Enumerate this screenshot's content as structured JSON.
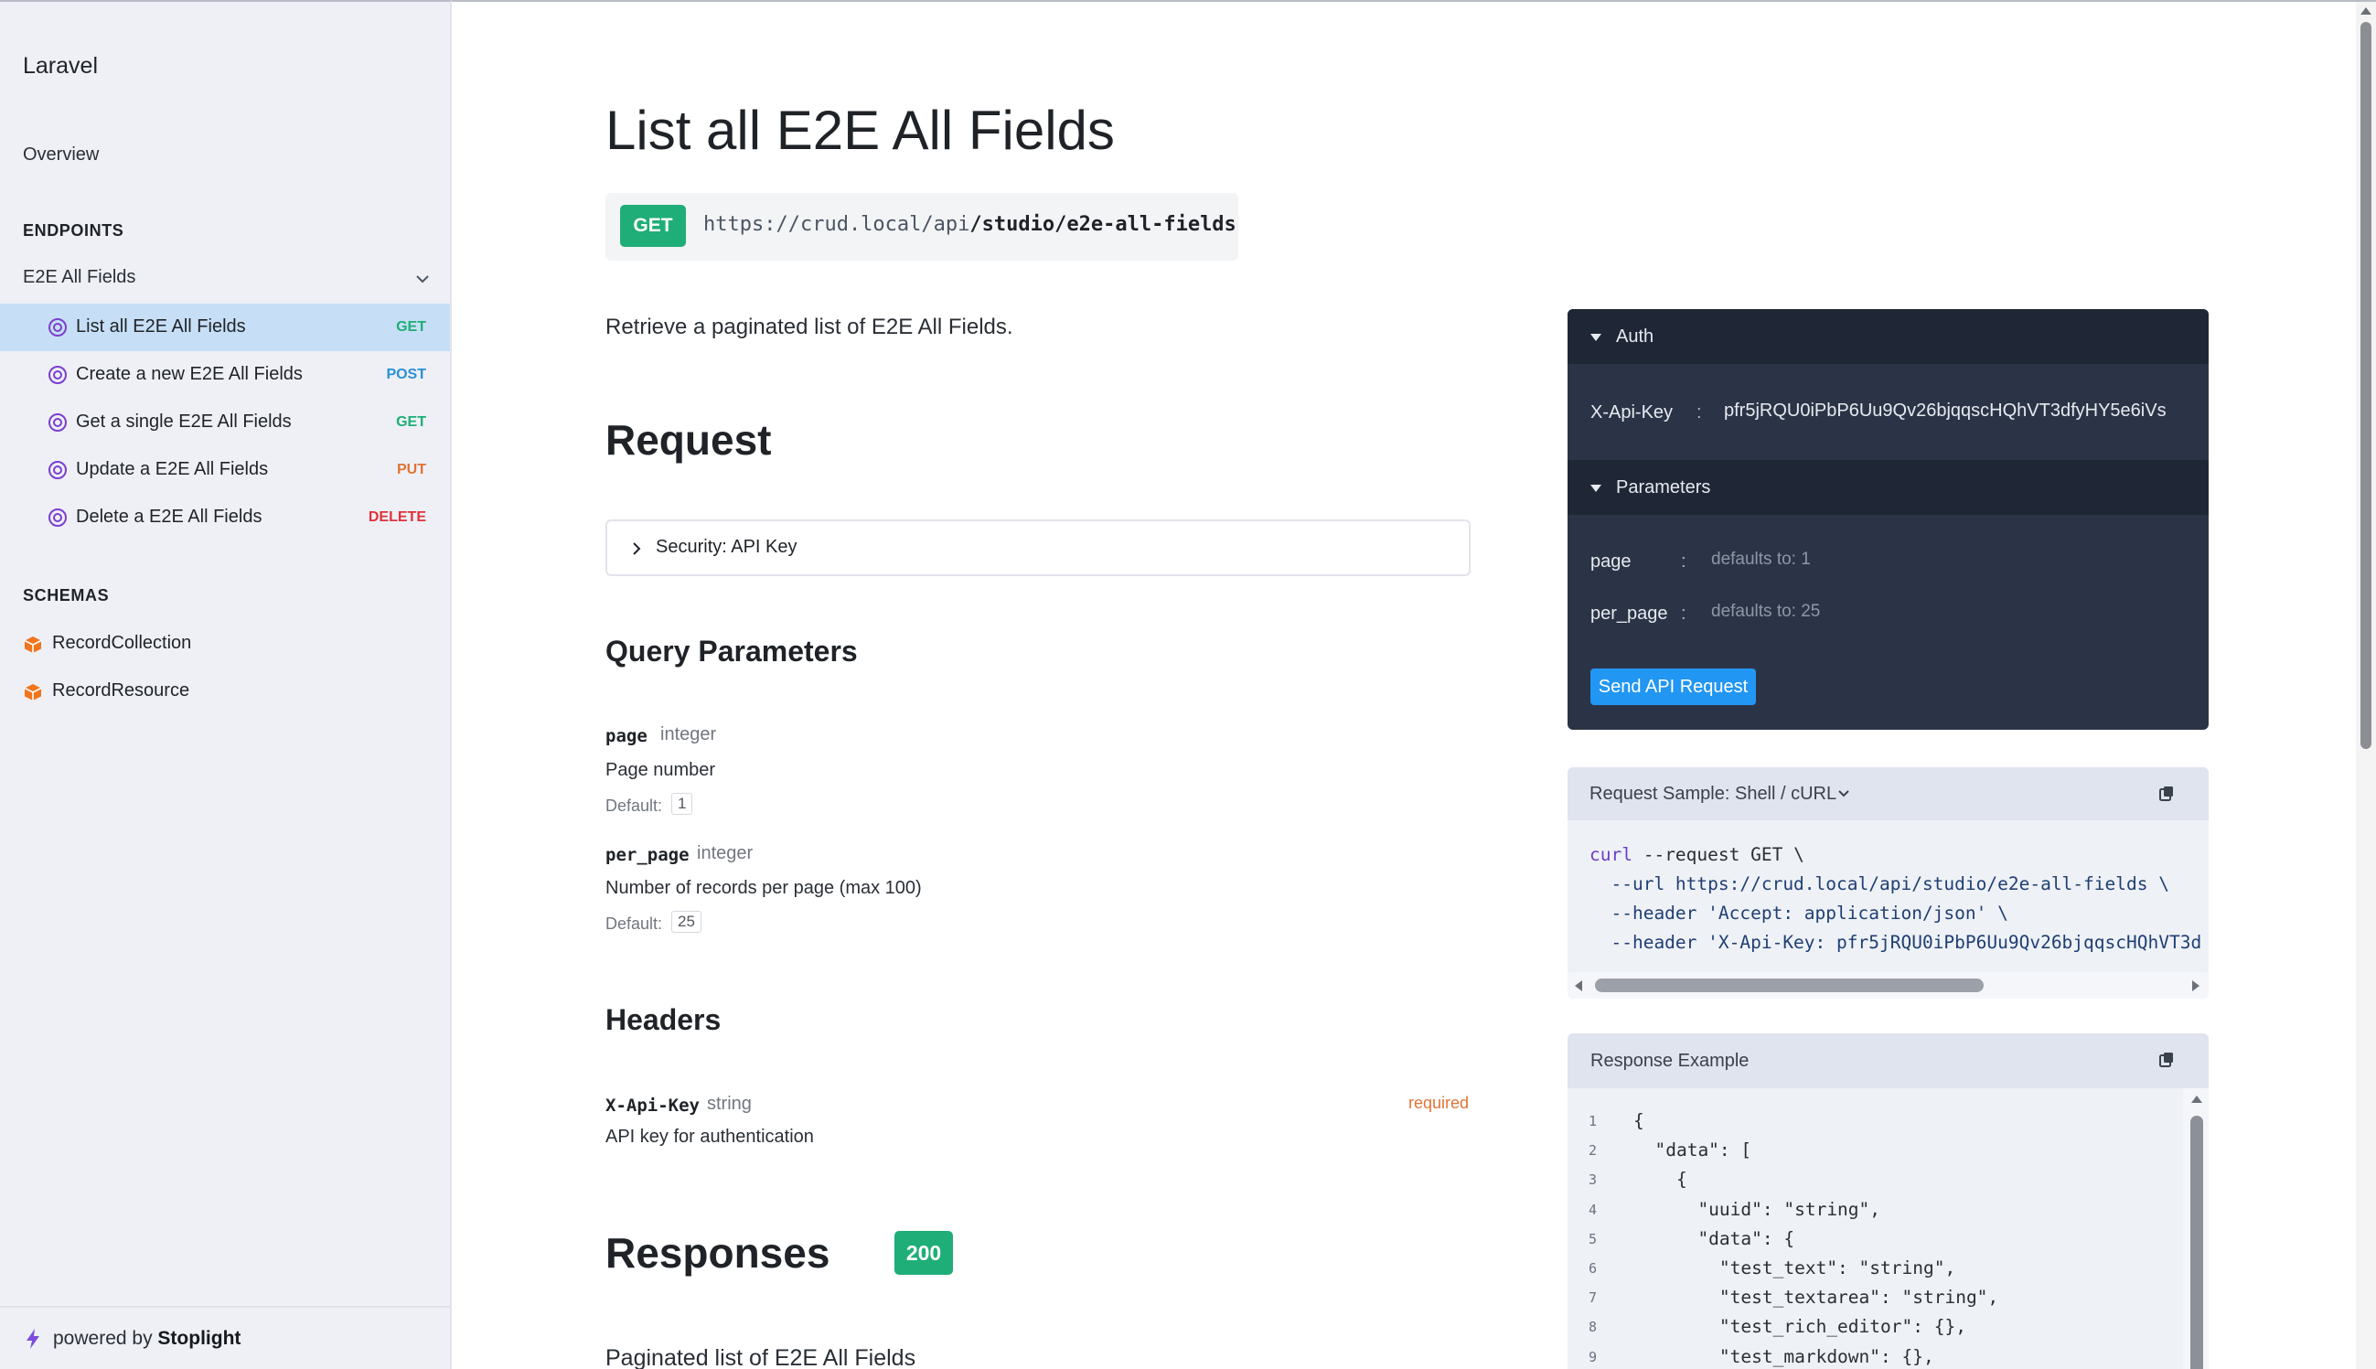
{
  "sidebar": {
    "brand": "Laravel",
    "overview": "Overview",
    "endpoints_title": "ENDPOINTS",
    "group_label": "E2E All Fields",
    "items": [
      {
        "label": "List all E2E All Fields",
        "method": "GET"
      },
      {
        "label": "Create a new E2E All Fields",
        "method": "POST"
      },
      {
        "label": "Get a single E2E All Fields",
        "method": "GET"
      },
      {
        "label": "Update a E2E All Fields",
        "method": "PUT"
      },
      {
        "label": "Delete a E2E All Fields",
        "method": "DELETE"
      }
    ],
    "schemas_title": "SCHEMAS",
    "schemas": [
      "RecordCollection",
      "RecordResource"
    ],
    "footer_prefix": "powered by",
    "footer_brand": "Stoplight"
  },
  "main": {
    "title": "List all E2E All Fields",
    "method": "GET",
    "url_base": "https://crud.local/api",
    "url_path": "/studio/e2e-all-fields",
    "description": "Retrieve a paginated list of E2E All Fields.",
    "request_heading": "Request",
    "security_label": "Security: API Key",
    "query_heading": "Query Parameters",
    "params": [
      {
        "name": "page",
        "type": "integer",
        "desc": "Page number",
        "default_label": "Default:",
        "default": "1"
      },
      {
        "name": "per_page",
        "type": "integer",
        "desc": "Number of records per page (max 100)",
        "default_label": "Default:",
        "default": "25"
      }
    ],
    "headers_heading": "Headers",
    "header_param": {
      "name": "X-Api-Key",
      "type": "string",
      "desc": "API key for authentication",
      "required": "required"
    },
    "responses_heading": "Responses",
    "response_code": "200",
    "response_desc": "Paginated list of E2E All Fields"
  },
  "tryit": {
    "auth_label": "Auth",
    "api_key_name": "X-Api-Key",
    "colon": ":",
    "api_key_value": "pfr5jRQU0iPbP6Uu9Qv26bjqqscHQhVT3dfyHY5e6iVs",
    "params_label": "Parameters",
    "params": [
      {
        "name": "page",
        "placeholder": "defaults to: 1"
      },
      {
        "name": "per_page",
        "placeholder": "defaults to: 25"
      }
    ],
    "send_label": "Send API Request"
  },
  "sample": {
    "header": "Request Sample: Shell / cURL",
    "lines": [
      {
        "cmd": "curl",
        "rest": " --request GET \\"
      },
      {
        "cmd": "",
        "rest": "  --url https://crud.local/api/studio/e2e-all-fields \\"
      },
      {
        "cmd": "",
        "rest": "  --header 'Accept: application/json' \\"
      },
      {
        "cmd": "",
        "rest": "  --header 'X-Api-Key: pfr5jRQU0iPbP6Uu9Qv26bjqqscHQhVT3d"
      }
    ]
  },
  "response_example": {
    "header": "Response Example",
    "lines": [
      {
        "n": "1",
        "code": "{"
      },
      {
        "n": "2",
        "code": "  \"data\": ["
      },
      {
        "n": "3",
        "code": "    {"
      },
      {
        "n": "4",
        "code": "      \"uuid\": \"string\","
      },
      {
        "n": "5",
        "code": "      \"data\": {"
      },
      {
        "n": "6",
        "code": "        \"test_text\": \"string\","
      },
      {
        "n": "7",
        "code": "        \"test_textarea\": \"string\","
      },
      {
        "n": "8",
        "code": "        \"test_rich_editor\": {},"
      },
      {
        "n": "9",
        "code": "        \"test_markdown\": {},"
      }
    ]
  },
  "colors": {
    "get": "#1fae77",
    "post": "#2b8fd6",
    "put": "#e07436",
    "delete": "#e0323a",
    "active_nav": "#c7dff6",
    "panel_dark": "#2b3447",
    "button_blue": "#2196f3"
  }
}
